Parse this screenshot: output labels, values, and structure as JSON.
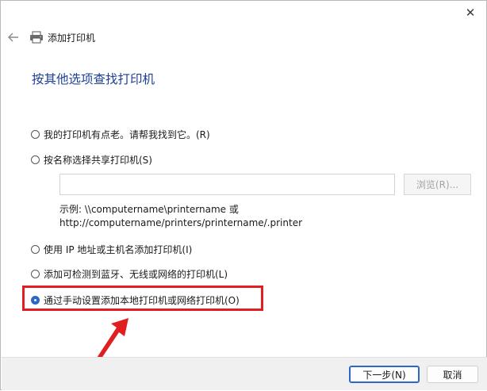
{
  "window": {
    "close_glyph": "✕"
  },
  "header": {
    "back_icon": "arrow-left-icon",
    "printer_icon": "printer-icon",
    "title": "添加打印机"
  },
  "heading": "按其他选项查找打印机",
  "options": [
    {
      "label": "我的打印机有点老。请帮我找到它。(R)",
      "checked": false
    },
    {
      "label": "按名称选择共享打印机(S)",
      "checked": false
    },
    {
      "label": "使用 IP 地址或主机名添加打印机(I)",
      "checked": false
    },
    {
      "label": "添加可检测到蓝牙、无线或网络的打印机(L)",
      "checked": false
    },
    {
      "label": "通过手动设置添加本地打印机或网络打印机(O)",
      "checked": true
    }
  ],
  "share": {
    "input_value": "",
    "browse_label": "浏览(R)...",
    "example_line1": "示例: \\\\computername\\printername 或",
    "example_line2": "http://computername/printers/printername/.printer"
  },
  "annotation": {
    "highlight_color": "#e02020"
  },
  "footer": {
    "next_label": "下一步(N)",
    "cancel_label": "取消"
  }
}
